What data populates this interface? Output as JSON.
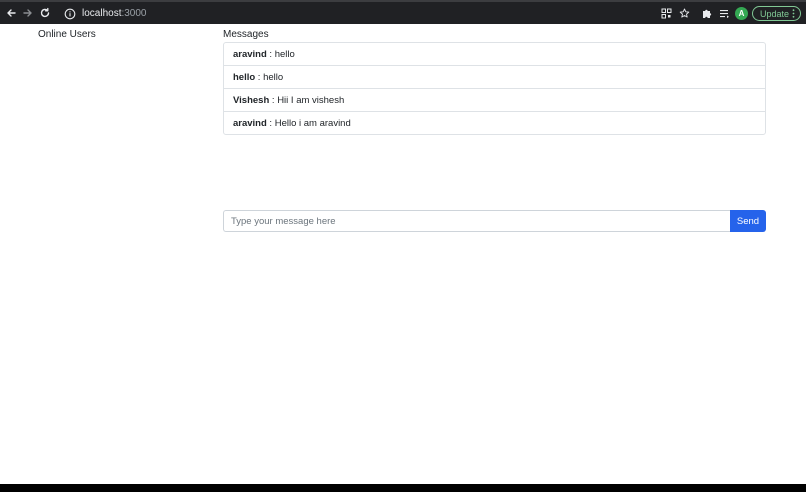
{
  "browser": {
    "url_host": "localhost",
    "url_port": ":3000",
    "icons": [
      "back-arrow-icon",
      "forward-arrow-icon",
      "reload-icon",
      "site-info-icon",
      "qr-code-icon",
      "bookmark-star-icon",
      "extensions-puzzle-icon",
      "reading-list-icon",
      "menu-dots-icon"
    ],
    "avatar_initial": "A",
    "update_label": "Update",
    "chrome_color": "#202124",
    "update_color": "#81c995"
  },
  "sidebar": {
    "title": "Online Users"
  },
  "messages": {
    "title": "Messages",
    "separator": " : ",
    "items": [
      {
        "user": "aravind",
        "text": "hello"
      },
      {
        "user": "hello",
        "text": "hello"
      },
      {
        "user": "Vishesh",
        "text": "Hii I am vishesh"
      },
      {
        "user": "aravind",
        "text": "Hello i am aravind"
      }
    ]
  },
  "composer": {
    "placeholder": "Type your message here",
    "value": "",
    "send_label": "Send",
    "send_color": "#2563eb"
  }
}
